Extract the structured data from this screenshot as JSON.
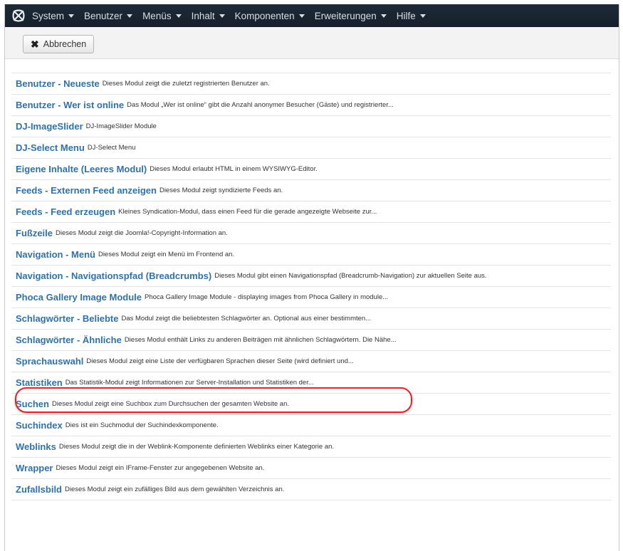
{
  "navbar": {
    "logo_icon": "joomla-logo-icon",
    "menus": [
      {
        "label": "System"
      },
      {
        "label": "Benutzer"
      },
      {
        "label": "Menüs"
      },
      {
        "label": "Inhalt"
      },
      {
        "label": "Komponenten"
      },
      {
        "label": "Erweiterungen"
      },
      {
        "label": "Hilfe"
      }
    ]
  },
  "toolbar": {
    "cancel_label": "Abbrechen",
    "cancel_icon": "close-icon"
  },
  "modules": [
    {
      "title": "Benutzer - Neueste",
      "desc": "Dieses Modul zeigt die zuletzt registrierten Benutzer an."
    },
    {
      "title": "Benutzer - Wer ist online",
      "desc": "Das Modul „Wer ist online“ gibt die Anzahl anonymer Besucher (Gäste) und registrierter..."
    },
    {
      "title": "DJ-ImageSlider",
      "desc": "DJ-ImageSlider Module"
    },
    {
      "title": "DJ-Select Menu",
      "desc": "DJ-Select Menu"
    },
    {
      "title": "Eigene Inhalte (Leeres Modul)",
      "desc": "Dieses Modul erlaubt HTML in einem WYSIWYG-Editor."
    },
    {
      "title": "Feeds - Externen Feed anzeigen",
      "desc": "Dieses Modul zeigt syndizierte Feeds an."
    },
    {
      "title": "Feeds - Feed erzeugen",
      "desc": "Kleines Syndication-Modul, dass einen Feed für die gerade angezeigte Webseite zur..."
    },
    {
      "title": "Fußzeile",
      "desc": "Dieses Modul zeigt die Joomla!-Copyright-Information an."
    },
    {
      "title": "Navigation - Menü",
      "desc": "Dieses Modul zeigt ein Menü im Frontend an."
    },
    {
      "title": "Navigation - Navigationspfad (Breadcrumbs)",
      "desc": "Dieses Modul gibt einen Navigationspfad (Breadcrumb-Navigation) zur aktuellen Seite aus."
    },
    {
      "title": "Phoca Gallery Image Module",
      "desc": "Phoca Gallery Image Module - displaying images from Phoca Gallery in module..."
    },
    {
      "title": "Schlagwörter - Beliebte",
      "desc": "Das Modul zeigt die beliebtesten Schlagwörter an. Optional aus einer bestimmten..."
    },
    {
      "title": "Schlagwörter - Ähnliche",
      "desc": "Dieses Modul enthält Links zu anderen Beiträgen mit ähnlichen Schlagwörtern. Die Nähe..."
    },
    {
      "title": "Sprachauswahl",
      "desc": "Dieses Modul zeigt eine Liste der verfügbaren Sprachen dieser Seite (wird definiert und..."
    },
    {
      "title": "Statistiken",
      "desc": "Das Statistik-Modul zeigt Informationen zur Server-Installation und Statistiken der..."
    },
    {
      "title": "Suchen",
      "desc": "Dieses Modul zeigt eine Suchbox zum Durchsuchen der gesamten Website an."
    },
    {
      "title": "Suchindex",
      "desc": "Dies ist ein Suchmodul der Suchindexkomponente."
    },
    {
      "title": "Weblinks",
      "desc": "Dieses Modul zeigt die in der Weblink-Komponente definierten Weblinks einer Kategorie an."
    },
    {
      "title": "Wrapper",
      "desc": "Dieses Modul zeigt ein IFrame-Fenster zur angegebenen Website an."
    },
    {
      "title": "Zufallsbild",
      "desc": "Dieses Modul zeigt ein zufälliges Bild aus dem gewählten Verzeichnis an."
    }
  ],
  "colors": {
    "navbar_bg": "#1b2633",
    "link": "#3071a9",
    "highlight": "#e0262c"
  }
}
